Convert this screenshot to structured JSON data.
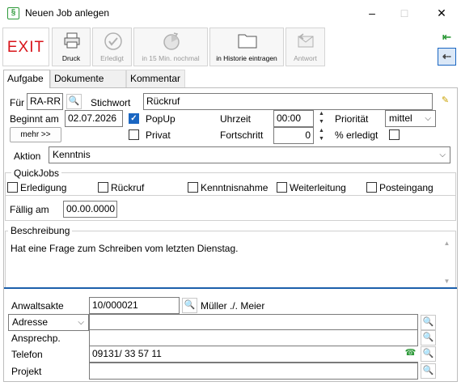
{
  "window": {
    "title": "Neuen Job anlegen",
    "minimize": "–",
    "maximize": "□",
    "close": "✕"
  },
  "toolbar": {
    "exit_label": "EXIT",
    "druck_label": "Druck",
    "erledigt_label": "Erledigt",
    "nochmal_label": "in 15 Min. nochmal",
    "historie_label": "in Historie eintragen",
    "antwort_label": "Antwort"
  },
  "tabs": [
    "Aufgabe",
    "Dokumente",
    "Kommentar"
  ],
  "form": {
    "fuer_label": "Für",
    "fuer_value": "RA-RR",
    "stichwort_label": "Stichwort",
    "stichwort_value": "Rückruf",
    "beginnt_label": "Beginnt am",
    "beginnt_value": "02.07.2026",
    "popup_label": "PopUp",
    "popup_checked": true,
    "privat_label": "Privat",
    "privat_checked": false,
    "uhrzeit_label": "Uhrzeit",
    "uhrzeit_value": "00:00",
    "fortschritt_label": "Fortschritt",
    "fortschritt_value": "0",
    "prioritaet_label": "Priorität",
    "prioritaet_value": "mittel",
    "erledigt_pct_label": "% erledigt",
    "mehr_label": "mehr >>",
    "aktion_label": "Aktion",
    "aktion_value": "Kenntnis"
  },
  "quickjobs": {
    "title": "QuickJobs",
    "items": [
      "Erledigung",
      "Rückruf",
      "Kenntnisnahme",
      "Weiterleitung",
      "Posteingang"
    ],
    "faellig_label": "Fällig am",
    "faellig_value": "00.00.0000"
  },
  "beschreibung": {
    "title": "Beschreibung",
    "text": "Hat eine Frage zum Schreiben vom letzten Dienstag."
  },
  "akte": {
    "anwaltsakte_label": "Anwaltsakte",
    "anwaltsakte_value": "10/000021",
    "parteien": "Müller ./. Meier",
    "adresse_label": "Adresse",
    "adresse_value": "",
    "ansprech_label": "Ansprechp.",
    "ansprech_value": "",
    "telefon_label": "Telefon",
    "telefon_value": "09131/ 33 57 11",
    "projekt_label": "Projekt",
    "projekt_value": ""
  },
  "colors": {
    "exit": "#d8141a",
    "accent_green": "#2e9a3a",
    "check_blue": "#1a66c2",
    "separator_blue": "#1c5fab"
  }
}
